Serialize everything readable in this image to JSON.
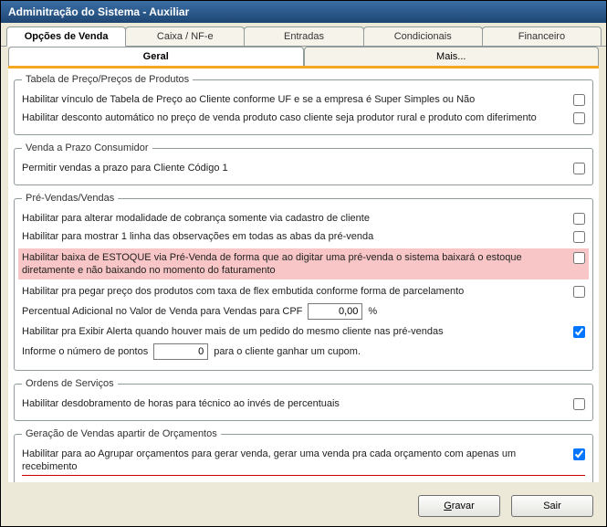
{
  "window_title": "Adminitração do Sistema - Auxiliar",
  "main_tabs": {
    "t0": "Opções de Venda",
    "t1": "Caixa / NF-e",
    "t2": "Entradas",
    "t3": "Condicionais",
    "t4": "Financeiro"
  },
  "sub_tabs": {
    "s0": "Geral",
    "s1": "Mais..."
  },
  "group_titles": {
    "g1": "Tabela de Preço/Preços de Produtos",
    "g2": "Venda a Prazo Consumidor",
    "g3": "Pré-Vendas/Vendas",
    "g4": "Ordens de Serviços",
    "g5": "Geração de Vendas apartir de Orçamentos"
  },
  "g1": {
    "r1": "Habilitar vínculo de Tabela de Preço ao Cliente conforme UF e se a empresa é Super Simples ou Não",
    "r2": "Habilitar desconto automático no preço de venda produto caso cliente seja produtor rural e produto com diferimento"
  },
  "g2": {
    "r1": "Permitir vendas a prazo para Cliente Código 1"
  },
  "g3": {
    "r1": "Habilitar para alterar modalidade de cobrança somente via cadastro de cliente",
    "r2": "Habilitar para mostrar 1 linha das observações em todas as abas da pré-venda",
    "r3": "Habilitar baixa de ESTOQUE via Pré-Venda de forma que ao digitar uma pré-venda o sistema baixará o estoque diretamente e não baixando no momento do faturamento",
    "r4": "Habilitar pra pegar preço dos produtos com taxa de flex embutida conforme forma de parcelamento",
    "r5_left": "Percentual Adicional no Valor de Venda para Vendas para CPF",
    "r5_value": "0,00",
    "r5_unit": "%",
    "r6": "Habilitar pra Exibir Alerta quando houver mais de um pedido do mesmo cliente nas pré-vendas",
    "r7_left": "Informe o número de pontos",
    "r7_value": "0",
    "r7_right": "para o cliente ganhar um cupom."
  },
  "g4": {
    "r1": "Habilitar desdobramento de horas para técnico ao invés de percentuais"
  },
  "g5": {
    "r1": "Habilitar para ao Agrupar orçamentos para gerar venda, gerar uma venda pra cada orçamento com apenas um recebimento"
  },
  "buttons": {
    "save": "Gravar",
    "exit": "Sair"
  }
}
